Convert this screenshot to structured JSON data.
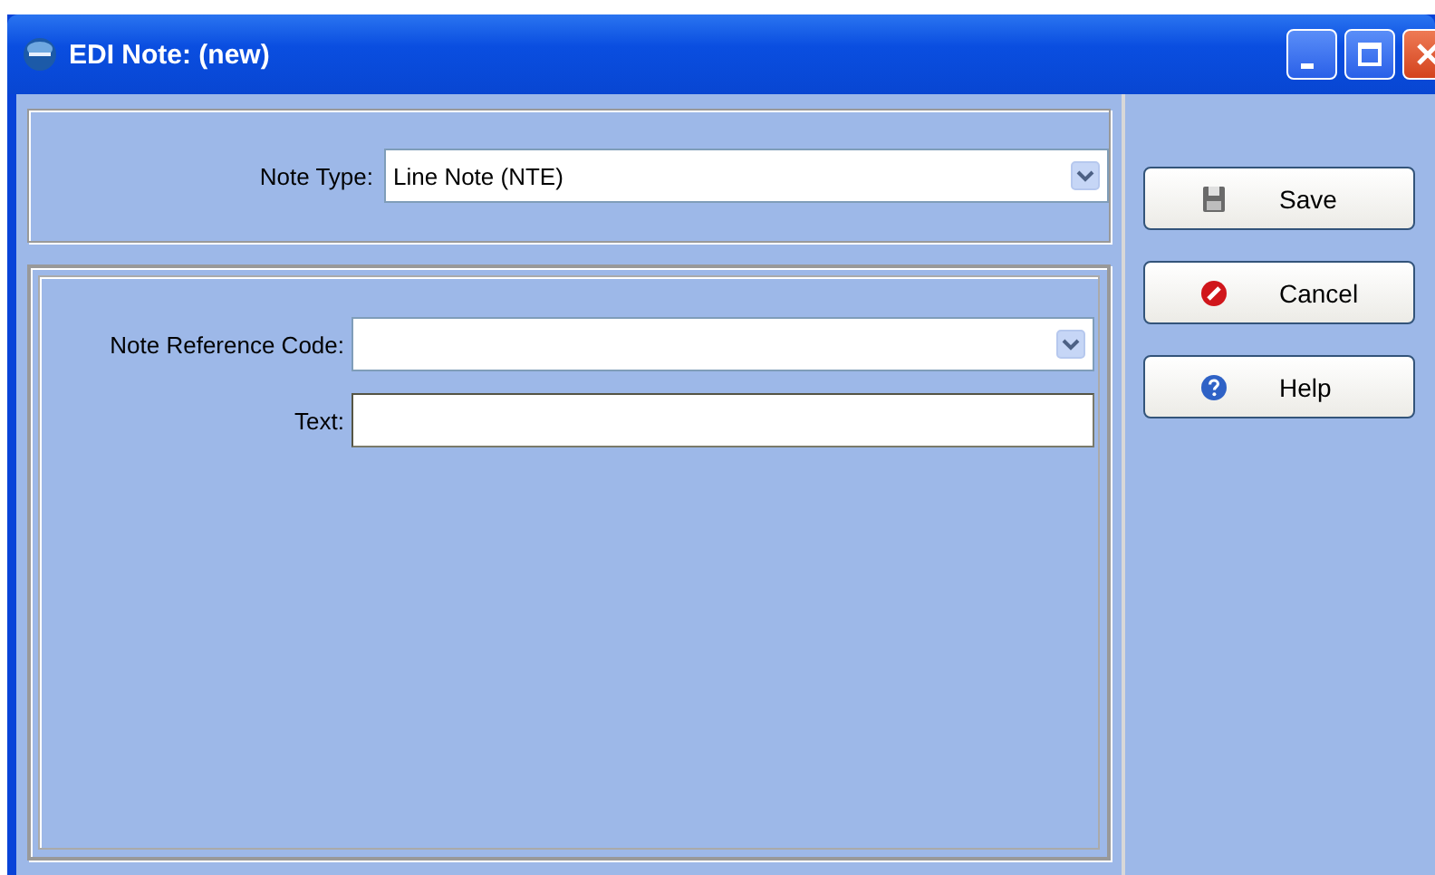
{
  "window": {
    "title": "EDI Note: (new)"
  },
  "note_type": {
    "label": "Note Type:",
    "value": "Line Note (NTE)"
  },
  "fields": [
    {
      "kind": "dropdown",
      "label": "Note Reference Code:"
    },
    {
      "kind": "text",
      "label": "Text:"
    }
  ],
  "buttons": [
    {
      "label": "Save"
    },
    {
      "label": "Cancel"
    },
    {
      "label": "Help"
    }
  ]
}
